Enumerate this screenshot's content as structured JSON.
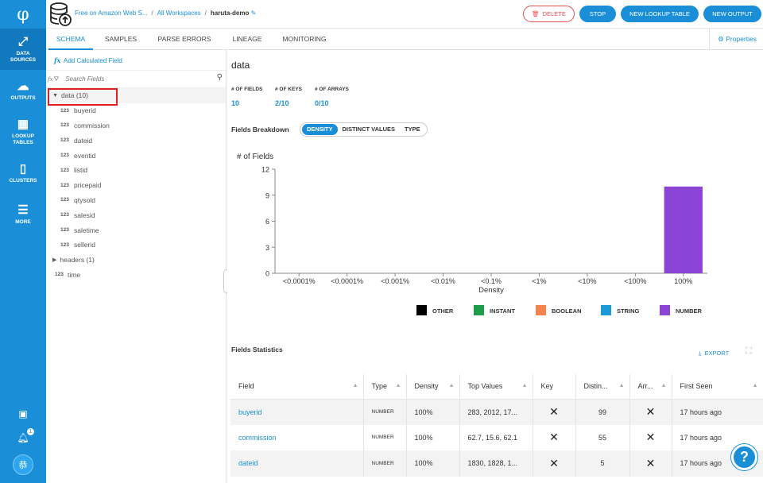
{
  "nav": {
    "logo": "φ",
    "items": [
      {
        "label_line1": "DATA",
        "label_line2": "SOURCES",
        "icon": "data-sources-icon",
        "active": true
      },
      {
        "label_line1": "OUTPUTS",
        "label_line2": "",
        "icon": "cloud-upload-icon",
        "active": false
      },
      {
        "label_line1": "LOOKUP",
        "label_line2": "TABLES",
        "icon": "table-icon",
        "active": false
      },
      {
        "label_line1": "CLUSTERS",
        "label_line2": "",
        "icon": "server-icon",
        "active": false
      },
      {
        "label_line1": "MORE",
        "label_line2": "",
        "icon": "menu-icon",
        "active": false
      }
    ],
    "notification_count": "1",
    "avatar_text": "恭"
  },
  "header": {
    "breadcrumb_source": "Free on Amazon Web S...",
    "breadcrumb_workspaces": "All Workspaces",
    "breadcrumb_current": "haruta-demo",
    "delete_label": "DELETE",
    "stop_label": "STOP",
    "new_lookup_label": "NEW LOOKUP TABLE",
    "new_output_label": "NEW OUTPUT"
  },
  "tabs": [
    "SCHEMA",
    "SAMPLES",
    "PARSE ERRORS",
    "LINEAGE",
    "MONITORING"
  ],
  "properties_label": "Properties",
  "schema": {
    "add_calc_label": "Add Calculated Field",
    "search_placeholder": "Search Fields",
    "root_label": "data (10)",
    "children": [
      "buyerid",
      "commission",
      "dateid",
      "eventid",
      "listid",
      "pricepaid",
      "qtysold",
      "salesid",
      "saletime",
      "sellerid"
    ],
    "type_badge": "123",
    "headers_label": "headers (1)",
    "time_label": "time"
  },
  "main": {
    "title": "data",
    "stats": [
      {
        "label": "# OF FIELDS",
        "value": "10"
      },
      {
        "label": "# OF KEYS",
        "value": "2/10"
      },
      {
        "label": "# OF ARRAYS",
        "value": "0/10"
      }
    ],
    "fields_breakdown_label": "Fields Breakdown",
    "segments": [
      "DENSITY",
      "DISTINCT VALUES",
      "TYPE"
    ],
    "fields_statistics_label": "Fields Statistics",
    "export_label": "EXPORT",
    "table": {
      "headers": [
        "Field",
        "Type",
        "Density",
        "Top Values",
        "Key",
        "Distin...",
        "Arr...",
        "First Seen"
      ],
      "rows": [
        {
          "field": "buyerid",
          "type": "NUMBER",
          "density": "100%",
          "top": "283, 2012, 17...",
          "distinct": "99",
          "first_seen": "17 hours ago"
        },
        {
          "field": "commission",
          "type": "NUMBER",
          "density": "100%",
          "top": "62.7, 15.6, 62.1",
          "distinct": "55",
          "first_seen": "17 hours ago"
        },
        {
          "field": "dateid",
          "type": "NUMBER",
          "density": "100%",
          "top": "1830, 1828, 1...",
          "distinct": "5",
          "first_seen": "17 hours ago"
        }
      ]
    }
  },
  "chart_data": {
    "type": "bar",
    "ylabel": "# of Fields",
    "xlabel": "Density",
    "categories": [
      "<0.0001%",
      "<0.0001%",
      "<0.001%",
      "<0.01%",
      "<0.1%",
      "<1%",
      "<10%",
      "<100%",
      "100%"
    ],
    "ylim": [
      0,
      12
    ],
    "yticks": [
      0,
      3,
      6,
      9,
      12
    ],
    "series": [
      {
        "name": "OTHER",
        "color": "#000000",
        "values": [
          0,
          0,
          0,
          0,
          0,
          0,
          0,
          0,
          0
        ]
      },
      {
        "name": "INSTANT",
        "color": "#1a9e4a",
        "values": [
          0,
          0,
          0,
          0,
          0,
          0,
          0,
          0,
          0
        ]
      },
      {
        "name": "BOOLEAN",
        "color": "#f5834e",
        "values": [
          0,
          0,
          0,
          0,
          0,
          0,
          0,
          0,
          0
        ]
      },
      {
        "name": "STRING",
        "color": "#1a9ad8",
        "values": [
          0,
          0,
          0,
          0,
          0,
          0,
          0,
          0,
          0
        ]
      },
      {
        "name": "NUMBER",
        "color": "#8b45d6",
        "values": [
          0,
          0,
          0,
          0,
          0,
          0,
          0,
          0,
          10
        ]
      }
    ],
    "legend_position": "bottom",
    "grid": false
  }
}
